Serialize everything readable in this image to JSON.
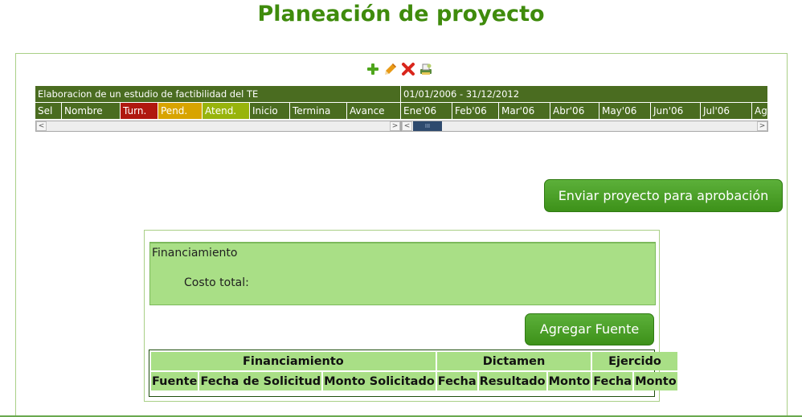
{
  "page": {
    "title": "Planeación de proyecto"
  },
  "toolbar": {
    "icons": [
      "plus-icon",
      "pencil-icon",
      "delete-x-icon",
      "print-icon"
    ],
    "colors": {
      "plus": "#4ea51c",
      "pencil": "#e89a16",
      "delete": "#d9261c"
    }
  },
  "gantt": {
    "task_title": "Elaboracion de un estudio de factibilidad del TE",
    "date_range": "01/01/2006 - 31/12/2012",
    "columns": [
      "Sel",
      "Nombre",
      "Turn.",
      "Pend.",
      "Atend.",
      "Inicio",
      "Termina",
      "Avance"
    ],
    "months": [
      "Ene'06",
      "Feb'06",
      "Mar'06",
      "Abr'06",
      "May'06",
      "Jun'06",
      "Jul'06",
      "Ag"
    ],
    "scroll_left_arrow": "<",
    "scroll_right_arrow": ">",
    "scroll_thumb": "III",
    "colors": {
      "header_bg": "#4a6c20",
      "turn": "#b0180f",
      "pend": "#d8a400",
      "atend": "#98b40c"
    }
  },
  "actions": {
    "send_label": "Enviar proyecto para aprobación",
    "add_source_label": "Agregar Fuente"
  },
  "financing": {
    "box_title": "Financiamiento",
    "cost_label": "Costo total:",
    "table": {
      "group_headers": [
        "Financiamiento",
        "Dictamen",
        "Ejercido"
      ],
      "columns": [
        "Fuente",
        "Fecha de Solicitud",
        "Monto Solicitado",
        "Fecha",
        "Resultado",
        "Monto",
        "Fecha",
        "Monto"
      ]
    }
  }
}
